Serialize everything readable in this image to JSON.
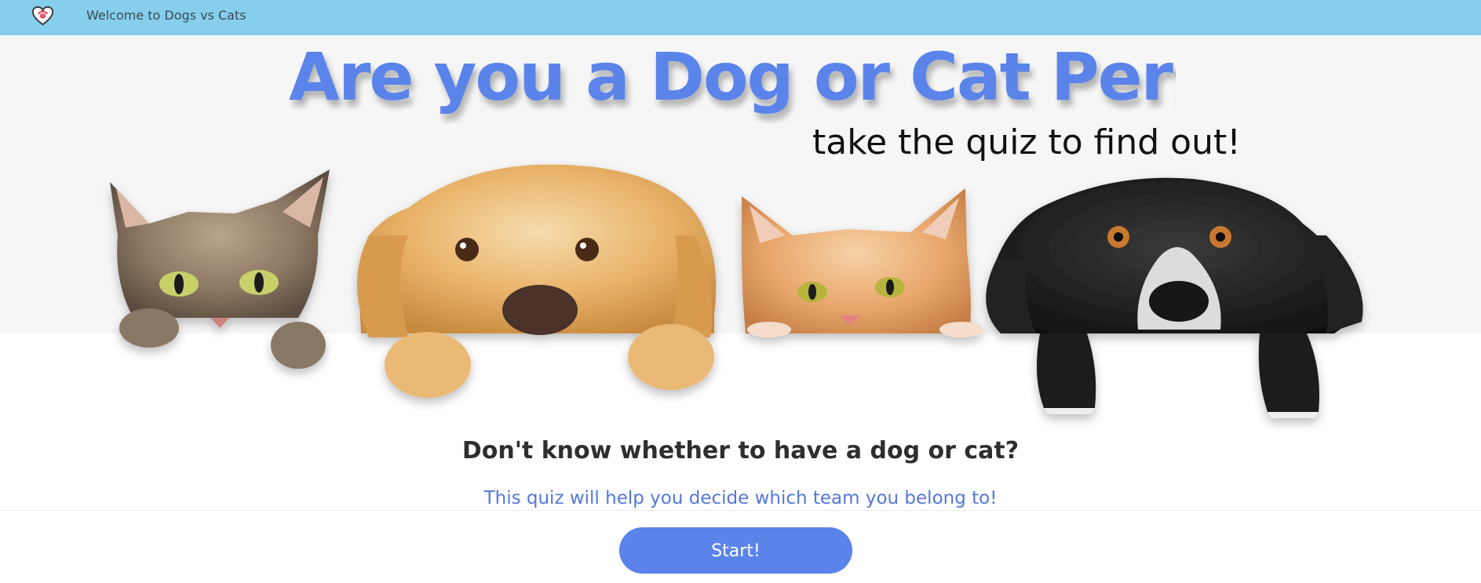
{
  "navbar": {
    "title": "Welcome to Dogs vs Cats",
    "logo_icon": "heart-paw-icon",
    "background": "#86CFEC"
  },
  "hero": {
    "title": "Are you a Dog or Cat Person?",
    "subtitle": "take the quiz to find out!",
    "title_color": "#5b84ea",
    "pets": [
      "tabby-cat",
      "golden-retriever-dog",
      "orange-cat",
      "black-white-dog"
    ]
  },
  "main": {
    "question": "Don't know whether to have a dog or cat?",
    "description": "This quiz will help you decide which team you belong to!",
    "start_label": "Start!",
    "accent": "#5b84ea"
  }
}
